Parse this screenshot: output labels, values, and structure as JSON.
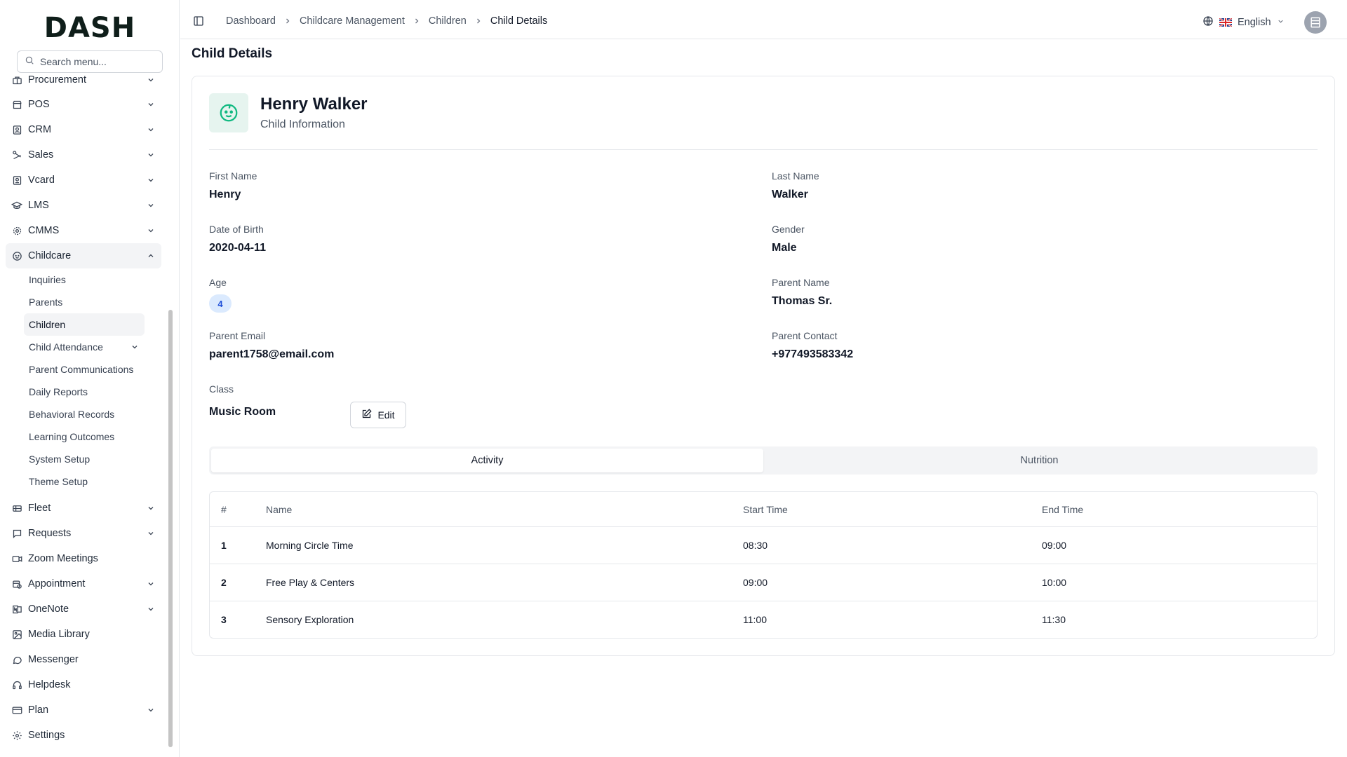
{
  "brand": {
    "logo_text": "DASH"
  },
  "search": {
    "placeholder": "Search menu..."
  },
  "sidebar": {
    "items": [
      {
        "label": "Procurement",
        "icon": "procurement-icon",
        "has_children": true
      },
      {
        "label": "POS",
        "icon": "store-icon",
        "has_children": true
      },
      {
        "label": "CRM",
        "icon": "crm-icon",
        "has_children": true
      },
      {
        "label": "Sales",
        "icon": "sales-icon",
        "has_children": true
      },
      {
        "label": "Vcard",
        "icon": "vcard-icon",
        "has_children": true
      },
      {
        "label": "LMS",
        "icon": "graduation-cap-icon",
        "has_children": true
      },
      {
        "label": "CMMS",
        "icon": "gear-icon",
        "has_children": true
      },
      {
        "label": "Childcare",
        "icon": "baby-icon",
        "has_children": true,
        "expanded": true
      }
    ],
    "childcare_sub": [
      {
        "label": "Inquiries"
      },
      {
        "label": "Parents"
      },
      {
        "label": "Children",
        "active": true
      },
      {
        "label": "Child Attendance",
        "has_children": true
      },
      {
        "label": "Parent Communications"
      },
      {
        "label": "Daily Reports"
      },
      {
        "label": "Behavioral Records"
      },
      {
        "label": "Learning Outcomes"
      },
      {
        "label": "System Setup"
      },
      {
        "label": "Theme Setup"
      }
    ],
    "items_after": [
      {
        "label": "Fleet",
        "icon": "fleet-icon",
        "has_children": true
      },
      {
        "label": "Requests",
        "icon": "message-square-icon",
        "has_children": true
      },
      {
        "label": "Zoom Meetings",
        "icon": "video-icon",
        "has_children": false
      },
      {
        "label": "Appointment",
        "icon": "calendar-clock-icon",
        "has_children": true
      },
      {
        "label": "OneNote",
        "icon": "onenote-icon",
        "has_children": true
      },
      {
        "label": "Media Library",
        "icon": "image-icon",
        "has_children": false
      },
      {
        "label": "Messenger",
        "icon": "chat-bubble-icon",
        "has_children": false
      },
      {
        "label": "Helpdesk",
        "icon": "headphones-icon",
        "has_children": false
      },
      {
        "label": "Plan",
        "icon": "credit-card-icon",
        "has_children": true
      },
      {
        "label": "Settings",
        "icon": "settings-icon",
        "has_children": false
      }
    ]
  },
  "header": {
    "breadcrumbs": [
      "Dashboard",
      "Childcare Management",
      "Children",
      "Child Details"
    ],
    "language": "English"
  },
  "page": {
    "title": "Child Details",
    "child_name": "Henry Walker",
    "child_subtitle": "Child Information"
  },
  "fields": {
    "first_name": {
      "label": "First Name",
      "value": "Henry"
    },
    "last_name": {
      "label": "Last Name",
      "value": "Walker"
    },
    "dob": {
      "label": "Date of Birth",
      "value": "2020-04-11"
    },
    "gender": {
      "label": "Gender",
      "value": "Male"
    },
    "age": {
      "label": "Age",
      "value": "4"
    },
    "parent_name": {
      "label": "Parent Name",
      "value": "Thomas Sr."
    },
    "parent_email": {
      "label": "Parent Email",
      "value": "parent1758@email.com"
    },
    "parent_contact": {
      "label": "Parent Contact",
      "value": "+977493583342"
    },
    "class": {
      "label": "Class",
      "value": "Music Room"
    }
  },
  "edit_label": "Edit",
  "tabs": [
    {
      "label": "Activity",
      "active": true
    },
    {
      "label": "Nutrition",
      "active": false
    }
  ],
  "table": {
    "headers": [
      "#",
      "Name",
      "Start Time",
      "End Time"
    ],
    "rows": [
      [
        "1",
        "Morning Circle Time",
        "08:30",
        "09:00"
      ],
      [
        "2",
        "Free Play & Centers",
        "09:00",
        "10:00"
      ],
      [
        "3",
        "Sensory Exploration",
        "11:00",
        "11:30"
      ]
    ]
  },
  "colors": {
    "accent": "#10b981",
    "badge_bg": "#dbeafe",
    "badge_text": "#1d4ed8"
  }
}
